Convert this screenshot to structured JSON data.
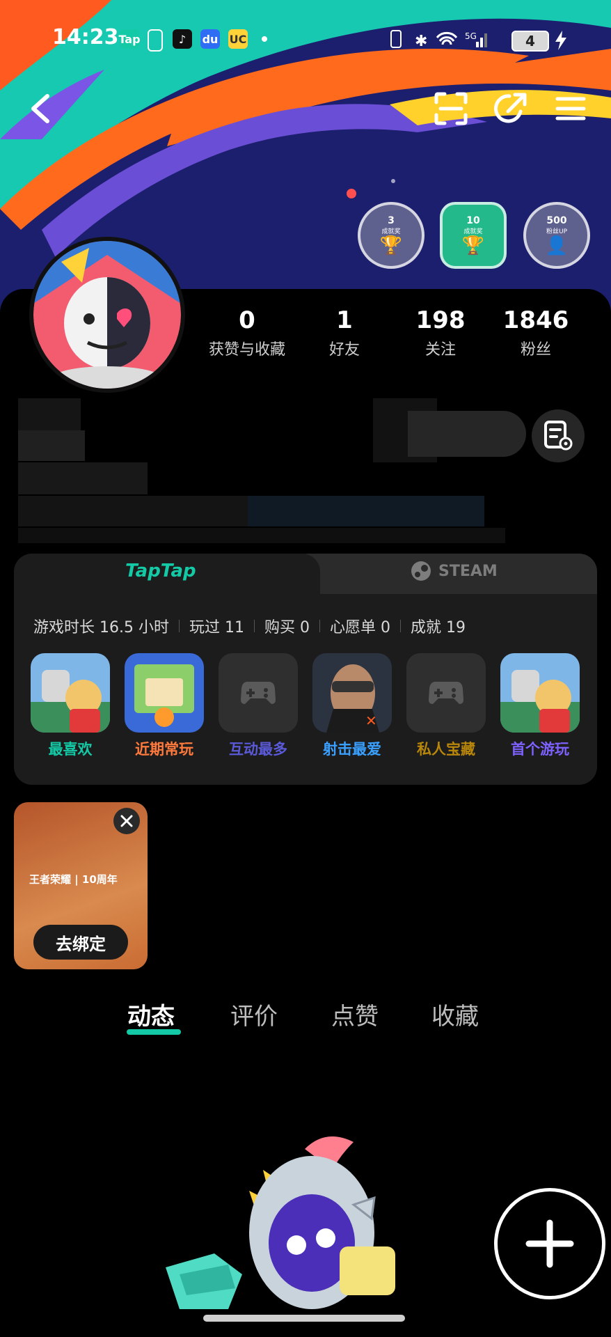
{
  "status_bar": {
    "time": "14:23",
    "app_icons": [
      "Tap",
      "TikTok",
      "Baidu",
      "UC"
    ],
    "battery": "4"
  },
  "nav": {
    "back_icon": "chevron-left-icon",
    "scan_icon": "scan-icon",
    "share_icon": "share-icon",
    "menu_icon": "menu-icon"
  },
  "badges": [
    {
      "value": "3",
      "caption": "成就奖"
    },
    {
      "value": "10",
      "caption": "成就奖"
    },
    {
      "value": "500",
      "caption": "粉丝UP"
    }
  ],
  "stats": [
    {
      "value": "0",
      "label": "获赞与收藏"
    },
    {
      "value": "1",
      "label": "好友"
    },
    {
      "value": "198",
      "label": "关注"
    },
    {
      "value": "1846",
      "label": "粉丝"
    }
  ],
  "games_card": {
    "tab_taptap": "TapTap",
    "tab_steam": "STEAM",
    "summary": [
      "游戏时长 16.5 小时",
      "玩过 11",
      "购买 0",
      "心愿单 0",
      "成就 19"
    ],
    "games": [
      {
        "label": "最喜欢",
        "color": "#14c9a5"
      },
      {
        "label": "近期常玩",
        "color": "#ff7a3c"
      },
      {
        "label": "互动最多",
        "color": "#5a5ad8"
      },
      {
        "label": "射击最爱",
        "color": "#3aa0ff"
      },
      {
        "label": "私人宝藏",
        "color": "#b8860b"
      },
      {
        "label": "首个游玩",
        "color": "#7d62ff"
      }
    ]
  },
  "promo": {
    "logo_text": "王者荣耀 | 10周年",
    "button": "去绑定"
  },
  "content_tabs": [
    "动态",
    "评价",
    "点赞",
    "收藏"
  ],
  "accent": "#14c9a5"
}
